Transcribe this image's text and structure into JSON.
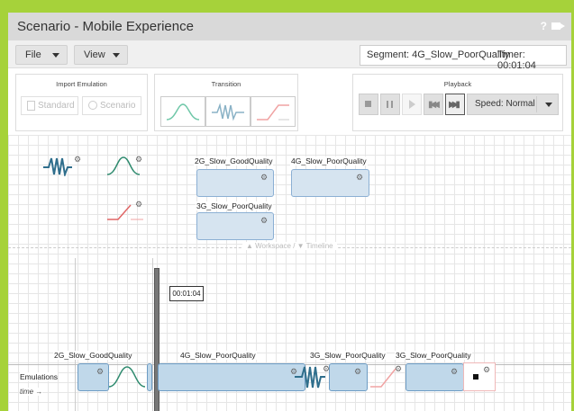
{
  "window": {
    "title": "Scenario - Mobile Experience",
    "help": "?"
  },
  "menu": {
    "file": "File",
    "view": "View"
  },
  "status": {
    "segment": "Segment: 4G_Slow_PoorQuality",
    "timer": "Timer: 00:01:04"
  },
  "import_panel": {
    "title": "Import Emulation",
    "standard": "Standard",
    "scenario": "Scenario"
  },
  "transition_panel": {
    "title": "Transition"
  },
  "playback_panel": {
    "title": "Playback",
    "speed": "Speed: Normal"
  },
  "library": {
    "labels": [
      "2G_Slow_GoodQuality",
      "4G_Slow_PoorQuality",
      "3G_Slow_PoorQuality"
    ]
  },
  "divider": {
    "label": "▲ Workspace / ▼ Timeline"
  },
  "timeline": {
    "playhead_time": "00:01:04",
    "row_label": "Emulations",
    "axis_label": "time →",
    "segments": [
      "2G_Slow_GoodQuality",
      "4G_Slow_PoorQuality",
      "3G_Slow_PoorQuality",
      "3G_Slow_PoorQuality"
    ]
  },
  "colors": {
    "accent": "#a6d23a",
    "wave": "#2f6e8c",
    "bell": "#2e8a6e",
    "ramp": "#e06666",
    "box": "#d6e4f0"
  }
}
